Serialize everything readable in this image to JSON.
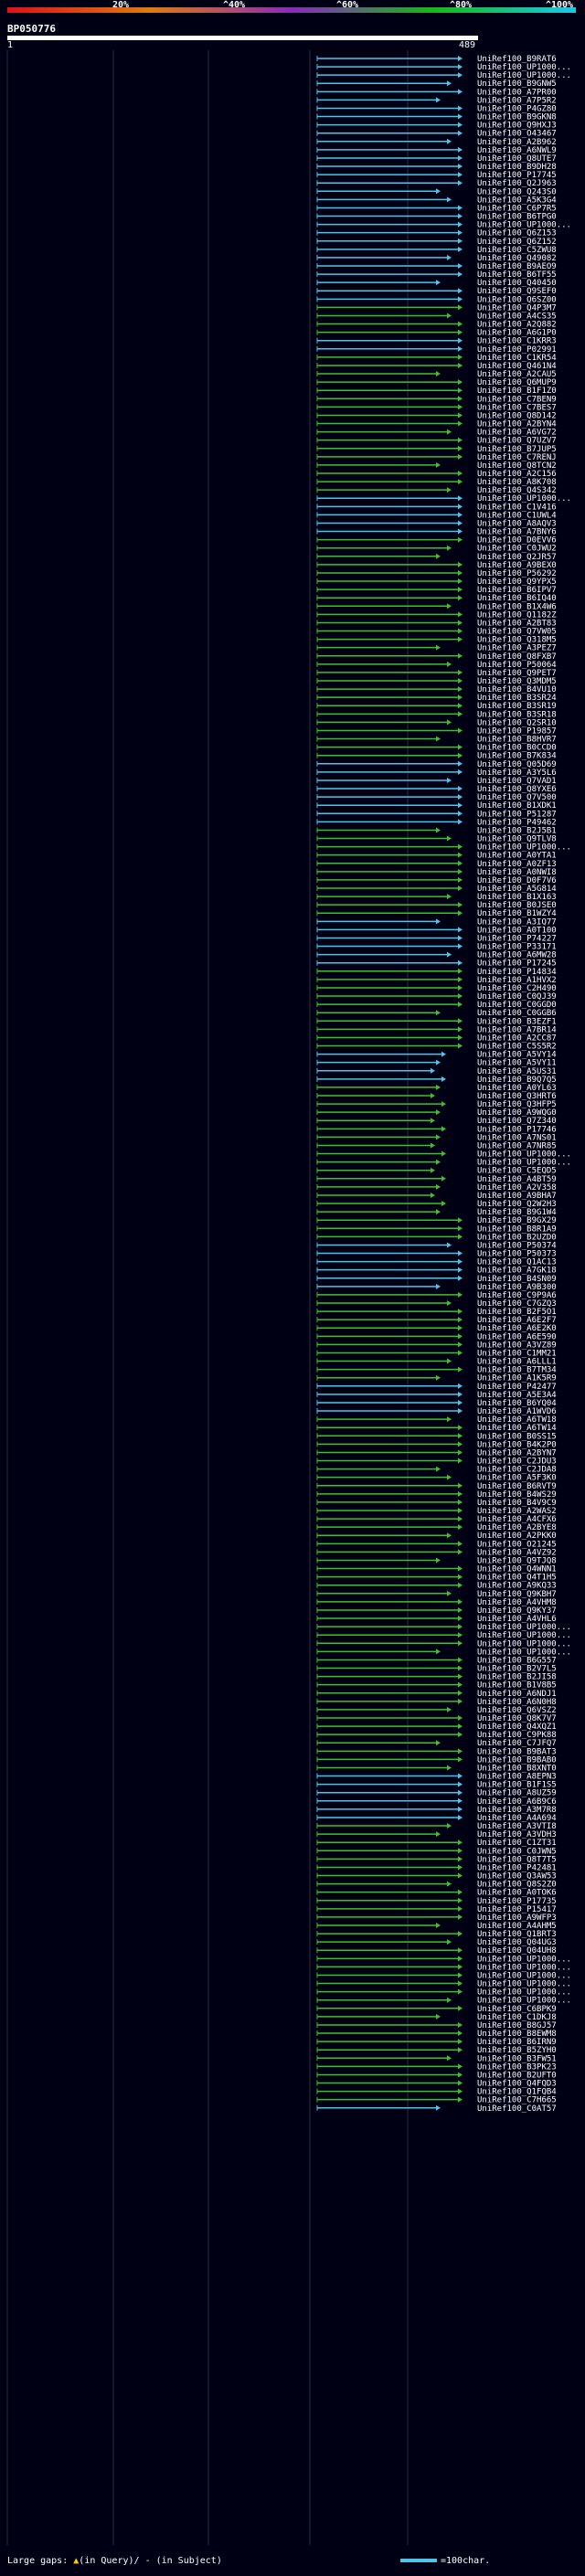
{
  "legend": {
    "ticks": [
      "20%",
      "^40%",
      "^60%",
      "^80%",
      "^100%"
    ],
    "colors": [
      "#e0101a",
      "#e07a10",
      "#8a2bb8",
      "#18b818",
      "#1ac8e8"
    ]
  },
  "query": {
    "name": "BP050776",
    "start": "1",
    "end": "489"
  },
  "hits": [
    "UniRef100_B9RAT6",
    "UniRef100_UP1000...",
    "UniRef100_UP1000...",
    "UniRef100_B9GNW5",
    "UniRef100_A7PR00",
    "UniRef100_A7P5R2",
    "UniRef100_P4GZ80",
    "UniRef100_B9GKN8",
    "UniRef100_Q9HXJ3",
    "UniRef100_O43467",
    "UniRef100_A2B962",
    "UniRef100_A6NWL9",
    "UniRef100_Q8UTE7",
    "UniRef100_B9DH28",
    "UniRef100_P17745",
    "UniRef100_Q2J963",
    "UniRef100_Q243S0",
    "UniRef100_A5K3G4",
    "UniRef100_C6P7R5",
    "UniRef100_B6TPG0",
    "UniRef100_UP1000...",
    "UniRef100_Q6Z153",
    "UniRef100_Q6Z152",
    "UniRef100_C5ZWU8",
    "UniRef100_Q49082",
    "UniRef100_B9AEO9",
    "UniRef100_B6TF55",
    "UniRef100_Q40450",
    "UniRef100_Q9SEF0",
    "UniRef100_Q6SZ00",
    "UniRef100_Q4P3M7",
    "UniRef100_A4CS35",
    "UniRef100_A2Q882",
    "UniRef100_A6G1P0",
    "UniRef100_C1KRR3",
    "UniRef100_P02991",
    "UniRef100_C1KR54",
    "UniRef100_Q461N4",
    "UniRef100_A2CAU5",
    "UniRef100_Q6MUP9",
    "UniRef100_B1F1Z0",
    "UniRef100_C7BEN9",
    "UniRef100_C7BES7",
    "UniRef100_Q8D142",
    "UniRef100_A2BYN4",
    "UniRef100_A6VG72",
    "UniRef100_Q7UZV7",
    "UniRef100_B7JUP5",
    "UniRef100_C7RENJ",
    "UniRef100_Q8TCN2",
    "UniRef100_A2C156",
    "UniRef100_A8K708",
    "UniRef100_Q4S342",
    "UniRef100_UP1000...",
    "UniRef100_C1V416",
    "UniRef100_C1UWL4",
    "UniRef100_A8AQV3",
    "UniRef100_A7BNY6",
    "UniRef100_D0EVV6",
    "UniRef100_C0JWU2",
    "UniRef100_Q2JR57",
    "UniRef100_A9BEX0",
    "UniRef100_P56292",
    "UniRef100_Q9YPX5",
    "UniRef100_B6IPV7",
    "UniRef100_B6IQ40",
    "UniRef100_B1X4W6",
    "UniRef100_Q1182Z",
    "UniRef100_A2BT83",
    "UniRef100_Q7VW05",
    "UniRef100_Q318M5",
    "UniRef100_A3PEZ7",
    "UniRef100_Q8FXB7",
    "UniRef100_P50064",
    "UniRef100_Q9PET7",
    "UniRef100_Q3MDM5",
    "UniRef100_B4VU10",
    "UniRef100_B3SR24",
    "UniRef100_B3SR19",
    "UniRef100_B3SR18",
    "UniRef100_Q2SR10",
    "UniRef100_P19857",
    "UniRef100_B8HVR7",
    "UniRef100_B0CCD0",
    "UniRef100_B7K834",
    "UniRef100_Q05D69",
    "UniRef100_A3Y5L6",
    "UniRef100_Q7VAD1",
    "UniRef100_Q8YXE6",
    "UniRef100_Q7V500",
    "UniRef100_B1XDK1",
    "UniRef100_P51287",
    "UniRef100_P49462",
    "UniRef100_B2J5B1",
    "UniRef100_Q9TLV8",
    "UniRef100_UP1000...",
    "UniRef100_A0YTA1",
    "UniRef100_A0ZF13",
    "UniRef100_A0NWI8",
    "UniRef100_D0F7V6",
    "UniRef100_A5G814",
    "UniRef100_B1X163",
    "UniRef100_B0JSE0",
    "UniRef100_B1WZY4",
    "UniRef100_A3IQ77",
    "UniRef100_A0T100",
    "UniRef100_P74227",
    "UniRef100_P33171",
    "UniRef100_A6MW28",
    "UniRef100_P17245",
    "UniRef100_P14834",
    "UniRef100_A1HVX2",
    "UniRef100_C2H490",
    "UniRef100_C0QJ39",
    "UniRef100_C0GGD0",
    "UniRef100_C0GGB6",
    "UniRef100_B3EZF1",
    "UniRef100_A7BR14",
    "UniRef100_A2CC87",
    "UniRef100_C5S5R2",
    "UniRef100_A5VY14",
    "UniRef100_A5VY11",
    "UniRef100_A5US31",
    "UniRef100_B9Q7Q5",
    "UniRef100_A0YL63",
    "UniRef100_Q3HRT6",
    "UniRef100_Q3HFP5",
    "UniRef100_A9WQG0",
    "UniRef100_Q7Z340",
    "UniRef100_P17746",
    "UniRef100_A7NS01",
    "UniRef100_A7NR85",
    "UniRef100_UP1000...",
    "UniRef100_UP1000...",
    "UniRef100_C5EQD5",
    "UniRef100_A4BT59",
    "UniRef100_A2V358",
    "UniRef100_A9BHA7",
    "UniRef100_Q2W2H3",
    "UniRef100_B9G1W4",
    "UniRef100_B9GX29",
    "UniRef100_B8R1A9",
    "UniRef100_B2UZD0",
    "UniRef100_P50374",
    "UniRef100_P50373",
    "UniRef100_Q1AC13",
    "UniRef100_A7GK18",
    "UniRef100_B4SN09",
    "UniRef100_A9B300",
    "UniRef100_C9P9A6",
    "UniRef100_C7GZQ3",
    "UniRef100_B2F5O1",
    "UniRef100_A6E2F7",
    "UniRef100_A6E2K0",
    "UniRef100_A6E590",
    "UniRef100_A3VZ89",
    "UniRef100_C1MM21",
    "UniRef100_A6LLL1",
    "UniRef100_B7TM34",
    "UniRef100_A1K5R9",
    "UniRef100_P42477",
    "UniRef100_A5E3A4",
    "UniRef100_B6YQ04",
    "UniRef100_A1WVD6",
    "UniRef100_A6TW18",
    "UniRef100_A6TW14",
    "UniRef100_B0SS15",
    "UniRef100_B4K2P0",
    "UniRef100_A2BYN7",
    "UniRef100_C2JDU3",
    "UniRef100_C2JDA8",
    "UniRef100_A5F3K0",
    "UniRef100_B6RVT9",
    "UniRef100_B4WS29",
    "UniRef100_B4V9C9",
    "UniRef100_A2WAS2",
    "UniRef100_A4CFX6",
    "UniRef100_A2BYE8",
    "UniRef100_A2PKK0",
    "UniRef100_O21245",
    "UniRef100_A4VZ92",
    "UniRef100_Q9TJQ8",
    "UniRef100_Q4WNN1",
    "UniRef100_Q4T1H5",
    "UniRef100_A9KQ33",
    "UniRef100_Q9KBH7",
    "UniRef100_A4VHM8",
    "UniRef100_Q9KY37",
    "UniRef100_A4VHL6",
    "UniRef100_UP1000...",
    "UniRef100_UP1000...",
    "UniRef100_UP1000...",
    "UniRef100_UP1000...",
    "UniRef100_B6G557",
    "UniRef100_B2V7L5",
    "UniRef100_B2JI58",
    "UniRef100_B1V8B5",
    "UniRef100_A6NDJ1",
    "UniRef100_A6N0H8",
    "UniRef100_Q6VSZ2",
    "UniRef100_Q8K7V7",
    "UniRef100_Q4XQZ1",
    "UniRef100_C9PK88",
    "UniRef100_C7JFQ7",
    "UniRef100_B9BAT3",
    "UniRef100_B9BAB0",
    "UniRef100_B8XNT0",
    "UniRef100_A8EPN3",
    "UniRef100_B1F1S5",
    "UniRef100_A8UZ59",
    "UniRef100_A6B9C6",
    "UniRef100_A3M7R8",
    "UniRef100_A4A694",
    "UniRef100_A3VTI8",
    "UniRef100_A3VDH3",
    "UniRef100_C1ZT31",
    "UniRef100_C0JWN5",
    "UniRef100_Q8T7T5",
    "UniRef100_P42481",
    "UniRef100_Q3AW53",
    "UniRef100_Q8S2Z0",
    "UniRef100_A0TOK6",
    "UniRef100_P17735",
    "UniRef100_P15417",
    "UniRef100_A9WFP3",
    "UniRef100_A4AHM5",
    "UniRef100_Q1BRT3",
    "UniRef100_Q04UG3",
    "UniRef100_Q04UH8",
    "UniRef100_UP1000...",
    "UniRef100_UP1000...",
    "UniRef100_UP1000...",
    "UniRef100_UP1000...",
    "UniRef100_UP1000...",
    "UniRef100_UP1000...",
    "UniRef100_C6BPK9",
    "UniRef100_C1DKJ8",
    "UniRef100_B8GJ57",
    "UniRef100_B8EWM8",
    "UniRef100_B6IRN9",
    "UniRef100_B5ZYH0",
    "UniRef100_B3FW51",
    "UniRef100_B3PK23",
    "UniRef100_B2UFT0",
    "UniRef100_Q4FQD3",
    "UniRef100_Q1FQB4",
    "UniRef100_C7H665",
    "UniRef100_C0AT57"
  ],
  "footer": {
    "gaps_label": "Large gaps:",
    "in_query": "(in Query)/",
    "in_subject": "- (in Subject)",
    "scale_key": "=100char."
  }
}
